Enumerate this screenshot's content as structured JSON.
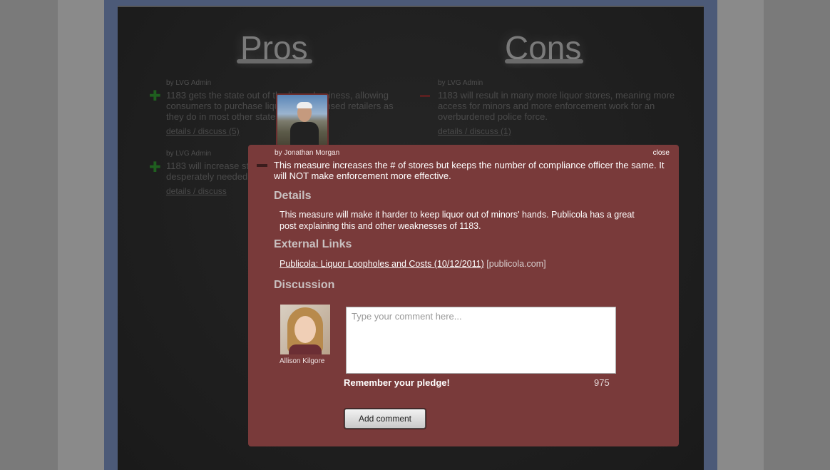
{
  "board": {
    "pros_title": "Pros",
    "cons_title": "Cons",
    "pros": [
      {
        "author": "by LVG Admin",
        "text": "1183 gets the state out of the liquor business, allowing consumers to purchase liquor from licensed retailers as they do in most other states.",
        "link": "details / discuss (5)"
      },
      {
        "author": "by LVG Admin",
        "text": "1183 will increase state revenue at a time when it is desperately needed.",
        "link": "details / discuss"
      }
    ],
    "cons": [
      {
        "author": "by LVG Admin",
        "text": "1183 will result in many more liquor stores, meaning more access for minors and more enforcement work for an overburdened police force.",
        "link": "details / discuss (1)"
      }
    ]
  },
  "modal": {
    "author": "by Jonathan Morgan",
    "close_label": "close",
    "statement": "This measure increases the # of stores but keeps the number of compliance officer the same. It will NOT make enforcement more effective.",
    "details_heading": "Details",
    "details_text": "This measure will make it harder to keep liquor out of minors' hands. Publicola has a great post explaining this and other weaknesses of 1183.",
    "links_heading": "External Links",
    "link_text": "Publicola: Liquor Loopholes and Costs (10/12/2011)",
    "link_domain": "[publicola.com]",
    "discussion_heading": "Discussion",
    "commenter_name": "Allison Kilgore",
    "comment_placeholder": "Type your comment here...",
    "pledge_text": "Remember your pledge!",
    "char_count": "975",
    "add_button_label": "Add comment"
  }
}
